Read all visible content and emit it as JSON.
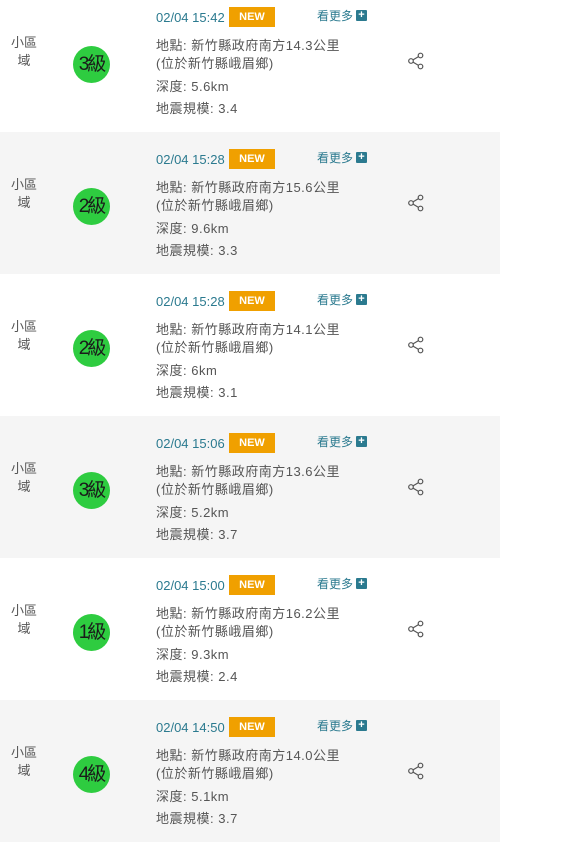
{
  "events": [
    {
      "area": "小區域",
      "level": "3級",
      "time": "02/04 15:42",
      "badge": "NEW",
      "more": "看更多",
      "location": "地點: 新竹縣政府南方14.3公里",
      "sublocation": "(位於新竹縣峨眉鄉)",
      "depth": "深度: 5.6km",
      "magnitude": "地震規模: 3.4"
    },
    {
      "area": "小區域",
      "level": "2級",
      "time": "02/04 15:28",
      "badge": "NEW",
      "more": "看更多",
      "location": "地點: 新竹縣政府南方15.6公里",
      "sublocation": "(位於新竹縣峨眉鄉)",
      "depth": "深度: 9.6km",
      "magnitude": "地震規模: 3.3"
    },
    {
      "area": "小區域",
      "level": "2級",
      "time": "02/04 15:28",
      "badge": "NEW",
      "more": "看更多",
      "location": "地點: 新竹縣政府南方14.1公里",
      "sublocation": "(位於新竹縣峨眉鄉)",
      "depth": "深度: 6km",
      "magnitude": "地震規模: 3.1"
    },
    {
      "area": "小區域",
      "level": "3級",
      "time": "02/04 15:06",
      "badge": "NEW",
      "more": "看更多",
      "location": "地點: 新竹縣政府南方13.6公里",
      "sublocation": "(位於新竹縣峨眉鄉)",
      "depth": "深度: 5.2km",
      "magnitude": "地震規模: 3.7"
    },
    {
      "area": "小區域",
      "level": "1級",
      "time": "02/04 15:00",
      "badge": "NEW",
      "more": "看更多",
      "location": "地點: 新竹縣政府南方16.2公里",
      "sublocation": "(位於新竹縣峨眉鄉)",
      "depth": "深度: 9.3km",
      "magnitude": "地震規模: 2.4"
    },
    {
      "area": "小區域",
      "level": "4級",
      "time": "02/04 14:50",
      "badge": "NEW",
      "more": "看更多",
      "location": "地點: 新竹縣政府南方14.0公里",
      "sublocation": "(位於新竹縣峨眉鄉)",
      "depth": "深度: 5.1km",
      "magnitude": "地震規模: 3.7"
    }
  ],
  "colors": {
    "level_badge": "#2ecc40",
    "new_badge": "#f0a000",
    "link": "#2b7a8f",
    "alt_row": "#f5f5f5"
  },
  "icons": {
    "more": "plus-square-icon",
    "share": "share-icon"
  }
}
